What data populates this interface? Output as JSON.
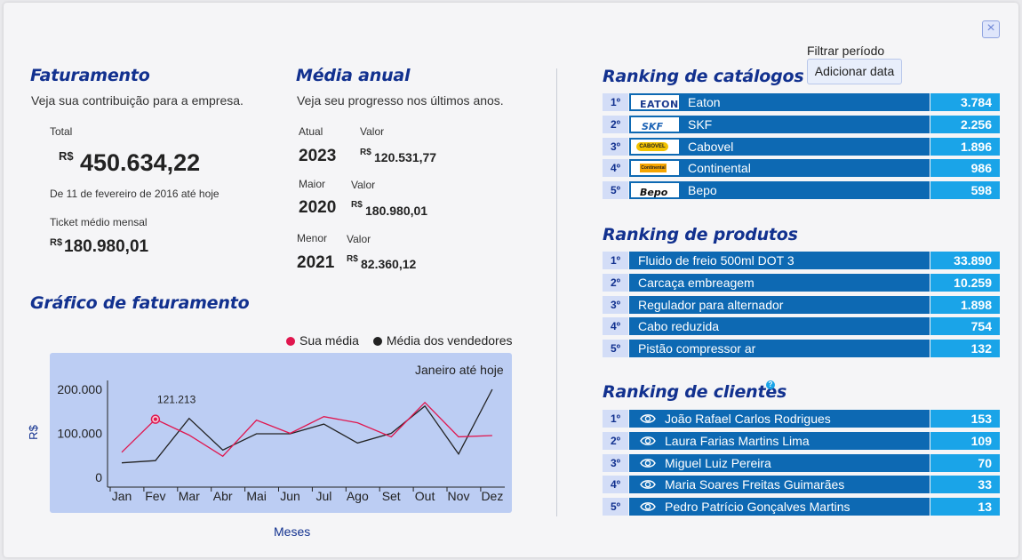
{
  "billing": {
    "title": "Faturamento",
    "subtitle": "Veja sua contribuição para a empresa.",
    "total_label": "Total",
    "currency": "R$",
    "total_value": "450.634,22",
    "period": "De 11 de fevereiro de 2016 até hoje",
    "ticket_label": "Ticket médio mensal",
    "ticket_value": "180.980,01"
  },
  "annual": {
    "title": "Média anual",
    "subtitle": "Veja seu progresso nos últimos anos.",
    "value_label": "Valor",
    "current_label": "Atual",
    "current_year": "2023",
    "current_value": "120.531,77",
    "max_label": "Maior",
    "max_year": "2020",
    "max_value": "180.980,01",
    "min_label": "Menor",
    "min_year": "2021",
    "min_value": "82.360,12"
  },
  "chart_section": {
    "title": "Gráfico de faturamento",
    "legend_own": "Sua média",
    "legend_sellers": "Média dos vendedores",
    "range_label": "Janeiro até hoje",
    "highlight_label": "121.213"
  },
  "chart_data": {
    "type": "line",
    "x": [
      "Jan",
      "Fev",
      "Mar",
      "Abr",
      "Mai",
      "Jun",
      "Jul",
      "Ago",
      "Set",
      "Out",
      "Nov",
      "Dez"
    ],
    "series": [
      {
        "name": "Sua média",
        "color": "#e0164e",
        "values": [
          57000,
          132000,
          96000,
          48000,
          130000,
          100000,
          138000,
          124000,
          92000,
          170000,
          92000,
          95000
        ]
      },
      {
        "name": "Média dos vendedores",
        "color": "#222222",
        "values": [
          33000,
          38000,
          134000,
          62000,
          99000,
          99000,
          121000,
          78000,
          100000,
          162000,
          53000,
          200000
        ]
      }
    ],
    "xlabel": "Meses",
    "ylabel": "R$",
    "yticks": [
      "200.000",
      "100.000",
      "0"
    ],
    "ylim": [
      0,
      220000
    ],
    "highlight": {
      "series": "Sua média",
      "x": "Fev",
      "value": 121213
    }
  },
  "filter": {
    "label": "Filtrar período",
    "button": "Adicionar data"
  },
  "catalogs": {
    "title": "Ranking de catálogos",
    "rows": [
      {
        "rank": "1º",
        "name": "Eaton",
        "value": "3.784",
        "logo": "EATON"
      },
      {
        "rank": "2º",
        "name": "SKF",
        "value": "2.256",
        "logo": "SKF"
      },
      {
        "rank": "3º",
        "name": "Cabovel",
        "value": "1.896",
        "logo": "CABOVEL"
      },
      {
        "rank": "4º",
        "name": "Continental",
        "value": "986",
        "logo": "Continental"
      },
      {
        "rank": "5º",
        "name": "Bepo",
        "value": "598",
        "logo": "Bepo"
      }
    ]
  },
  "products": {
    "title": "Ranking de produtos",
    "rows": [
      {
        "rank": "1º",
        "name": "Fluido de freio 500ml DOT 3",
        "value": "33.890"
      },
      {
        "rank": "2º",
        "name": "Carcaça embreagem",
        "value": "10.259"
      },
      {
        "rank": "3º",
        "name": "Regulador para alternador",
        "value": "1.898"
      },
      {
        "rank": "4º",
        "name": "Cabo reduzida",
        "value": "754"
      },
      {
        "rank": "5º",
        "name": "Pistão compressor ar",
        "value": "132"
      }
    ]
  },
  "clients": {
    "title": "Ranking de clientes",
    "help_icon": "?",
    "rows": [
      {
        "rank": "1º",
        "name": "João Rafael Carlos Rodrigues",
        "value": "153"
      },
      {
        "rank": "2º",
        "name": "Laura Farias Martins Lima",
        "value": "109"
      },
      {
        "rank": "3º",
        "name": "Miguel Luiz Pereira",
        "value": "70"
      },
      {
        "rank": "4º",
        "name": "Maria Soares Freitas Guimarães",
        "value": "33"
      },
      {
        "rank": "5º",
        "name": "Pedro Patrício Gonçalves Martins",
        "value": "13"
      }
    ]
  },
  "close_icon": "×"
}
